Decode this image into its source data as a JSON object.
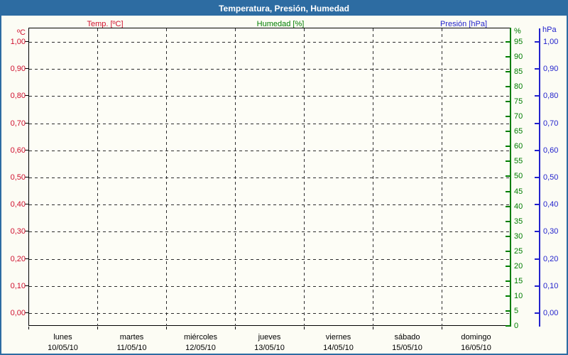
{
  "window": {
    "title": "Temperatura, Presión, Humedad"
  },
  "legend": {
    "temp": "Temp. [ºC]",
    "humidity": "Humedad [%]",
    "pressure": "Presión [hPa]"
  },
  "axis_units": {
    "temp": "ºC",
    "humidity": "%",
    "pressure": "hPa"
  },
  "colors": {
    "temp": "#cf0f2d",
    "humidity": "#007d00",
    "pressure": "#2222cc",
    "titlebar_bg": "#2d6ca2",
    "titlebar_text": "#ffffff",
    "grid": "#2b2b2b",
    "axis_black": "#000000",
    "background": "#fcfcf4",
    "border": "#2d6ca2"
  },
  "chart_data": {
    "type": "line",
    "title": "Temperatura, Presión, Humedad",
    "legend_position": "top",
    "grid": "dashed",
    "x": {
      "days": [
        {
          "name": "lunes",
          "date": "10/05/10"
        },
        {
          "name": "martes",
          "date": "11/05/10"
        },
        {
          "name": "miércoles",
          "date": "12/05/10"
        },
        {
          "name": "jueves",
          "date": "13/05/10"
        },
        {
          "name": "viernes",
          "date": "14/05/10"
        },
        {
          "name": "sábado",
          "date": "15/05/10"
        },
        {
          "name": "domingo",
          "date": "16/05/10"
        }
      ]
    },
    "y_axes": {
      "temperature": {
        "unit": "ºC",
        "side": "left",
        "color": "#cf0f2d",
        "min": 0,
        "max": 1,
        "step": 0.1,
        "tick_labels": [
          "1,00",
          "0,90",
          "0,80",
          "0,70",
          "0,60",
          "0,50",
          "0,40",
          "0,30",
          "0,20",
          "0,10",
          "0,00"
        ]
      },
      "humidity": {
        "unit": "%",
        "side": "right-inner",
        "color": "#007d00",
        "min": 0,
        "max": 100,
        "step": 5,
        "tick_labels": [
          "95",
          "90",
          "85",
          "80",
          "75",
          "70",
          "65",
          "60",
          "55",
          "50",
          "45",
          "40",
          "35",
          "30",
          "25",
          "20",
          "15",
          "10",
          "5",
          "0"
        ]
      },
      "pressure": {
        "unit": "hPa",
        "side": "right-outer",
        "color": "#2222cc",
        "min": 0,
        "max": 1,
        "step": 0.1,
        "tick_labels": [
          "1,00",
          "0,90",
          "0,80",
          "0,70",
          "0,60",
          "0,50",
          "0,40",
          "0,30",
          "0,20",
          "0,10",
          "0,00"
        ]
      }
    },
    "series": [
      {
        "name": "Temp. [ºC]",
        "color": "#cf0f2d",
        "values": []
      },
      {
        "name": "Humedad [%]",
        "color": "#007d00",
        "values": []
      },
      {
        "name": "Presión [hPa]",
        "color": "#2222cc",
        "values": []
      }
    ]
  }
}
